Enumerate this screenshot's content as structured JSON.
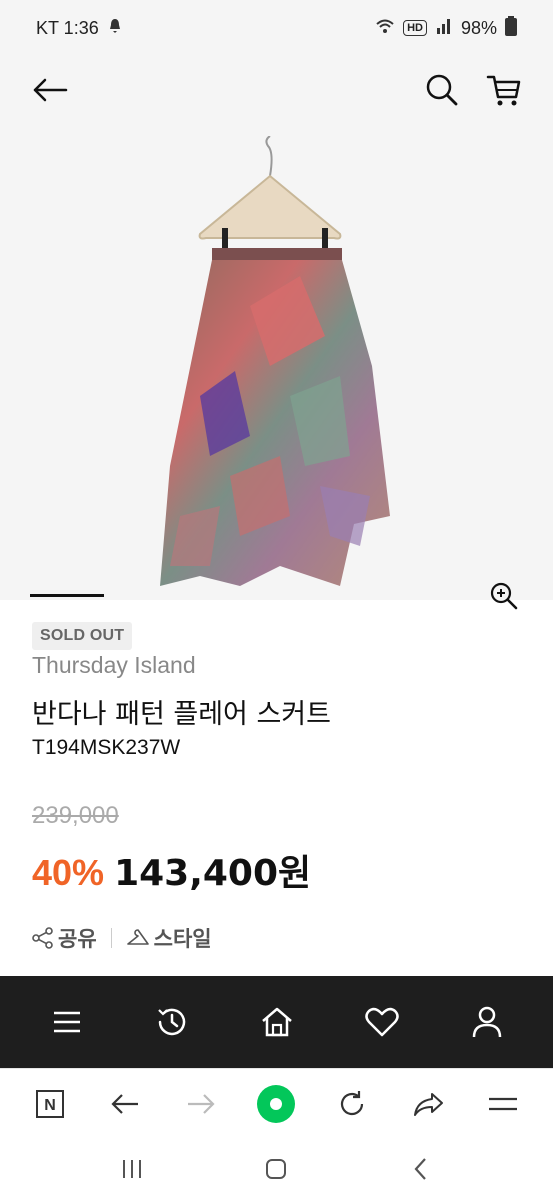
{
  "status": {
    "carrier_time": "KT 1:36",
    "battery": "98%",
    "hd": "HD"
  },
  "icons": {
    "back": "arrow-left-icon",
    "search": "search-icon",
    "cart": "cart-icon",
    "zoom": "zoom-in-icon",
    "share": "share-icon",
    "style": "hanger-icon",
    "menu": "menu-icon",
    "history": "history-icon",
    "home": "home-icon",
    "wishlist": "heart-icon",
    "profile": "user-icon"
  },
  "product": {
    "status_badge": "SOLD OUT",
    "brand": "Thursday Island",
    "name": "반다나 패턴 플레어 스커트",
    "code": "T194MSK237W",
    "original_price": "239,000",
    "discount": "40%",
    "sale_price": "143,400원",
    "share_label": "공유",
    "style_label": "스타일"
  },
  "colors": {
    "discount": "#f06427",
    "tabbar": "#1e1e1e",
    "naver_green": "#03c75a"
  },
  "browser": {
    "naver_logo": "N"
  }
}
